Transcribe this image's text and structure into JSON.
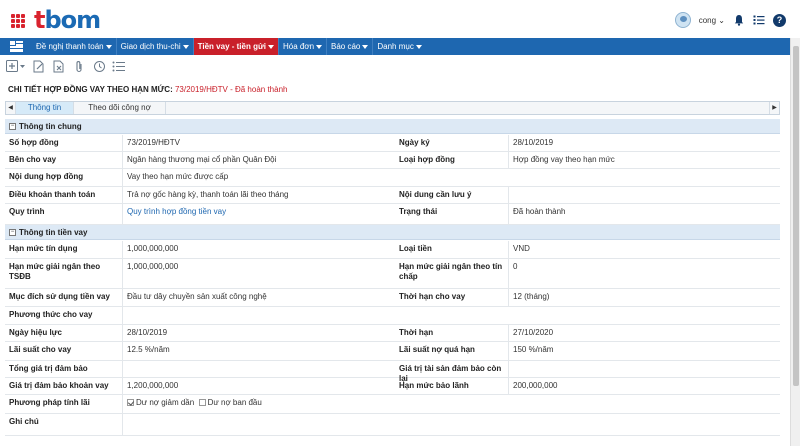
{
  "app": {
    "logo_prefix": "t",
    "logo_suffix": "bom"
  },
  "user": {
    "name": "cong",
    "caret": "⌄"
  },
  "nav": {
    "items": [
      {
        "label": "Đề nghị thanh toán",
        "active": false
      },
      {
        "label": "Giao dịch thu-chi",
        "active": false
      },
      {
        "label": "Tiền vay - tiền gửi",
        "active": true
      },
      {
        "label": "Hóa đơn",
        "active": false
      },
      {
        "label": "Báo cáo",
        "active": false
      },
      {
        "label": "Danh mục",
        "active": false
      }
    ]
  },
  "toolbar": {
    "icons": [
      "add-icon",
      "edit-icon",
      "delete-icon",
      "attach-icon",
      "history-icon",
      "list-icon"
    ]
  },
  "page": {
    "title": "CHI TIẾT HỢP ĐỒNG VAY THEO HẠN MỨC:",
    "code_status": " 73/2019/HĐTV - Đã hoàn thành"
  },
  "tabs": [
    {
      "label": "Thông tin",
      "active": true
    },
    {
      "label": "Theo dõi công nợ",
      "active": false
    }
  ],
  "general": {
    "section_title": "Thông tin chung",
    "rows": [
      {
        "l1": "Số hợp đồng",
        "v1": "73/2019/HĐTV",
        "l2": "Ngày ký",
        "v2": "28/10/2019"
      },
      {
        "l1": "Bên cho vay",
        "v1": "Ngân hàng thương mại cổ phần Quân Đội",
        "l2": "Loại hợp đồng",
        "v2": "Hợp đồng vay theo hạn mức"
      },
      {
        "l1": "Nội dung hợp đồng",
        "v1": "Vay theo hạn mức được cấp",
        "l2": "",
        "v2": ""
      },
      {
        "l1": "Điều khoản thanh toán",
        "v1": "Trả nợ gốc hàng kỳ, thanh toán lãi theo tháng",
        "l2": "Nội dung cần lưu ý",
        "v2": ""
      },
      {
        "l1": "Quy trình",
        "v1": "Quy trình hợp đồng tiền vay",
        "l2": "Trạng thái",
        "v2": "Đã hoàn thành"
      }
    ]
  },
  "loan": {
    "section_title": "Thông tin tiền vay",
    "rows": [
      {
        "l1": "Hạn mức tín dụng",
        "v1": "1,000,000,000",
        "l2": "Loại tiền",
        "v2": "VND"
      },
      {
        "l1": "Hạn mức giải ngân theo TSĐB",
        "v1": "1,000,000,000",
        "l2": "Hạn mức giải ngân theo tín chấp",
        "v2": "0"
      },
      {
        "l1": "Mục đích sử dụng tiền vay",
        "v1": "Đầu tư dây chuyền sản xuất công nghệ",
        "l2": "Thời hạn cho vay",
        "v2": "12 (tháng)"
      },
      {
        "l1": "Phương thức cho vay",
        "v1": "",
        "l2": "",
        "v2": ""
      },
      {
        "l1": "Ngày hiệu lực",
        "v1": "28/10/2019",
        "l2": "Thời hạn",
        "v2": "27/10/2020"
      },
      {
        "l1": "Lãi suất cho vay",
        "v1": "12.5 %/năm",
        "l2": "Lãi suất nợ quá hạn",
        "v2": "150 %/năm"
      },
      {
        "l1": "Tổng giá trị đảm bảo",
        "v1": "",
        "l2": "Giá trị tài sản đảm bảo còn lại",
        "v2": ""
      },
      {
        "l1": "Giá trị đảm bảo khoản vay",
        "v1": "1,200,000,000",
        "l2": "Hạn mức bảo lãnh",
        "v2": "200,000,000"
      }
    ],
    "method_label": "Phương pháp tính lãi",
    "method_options": [
      {
        "label": "Dư nợ giảm dần",
        "checked": true
      },
      {
        "label": "Dư nợ ban đầu",
        "checked": false
      }
    ],
    "note_label": "Ghi chú",
    "note_value": ""
  }
}
